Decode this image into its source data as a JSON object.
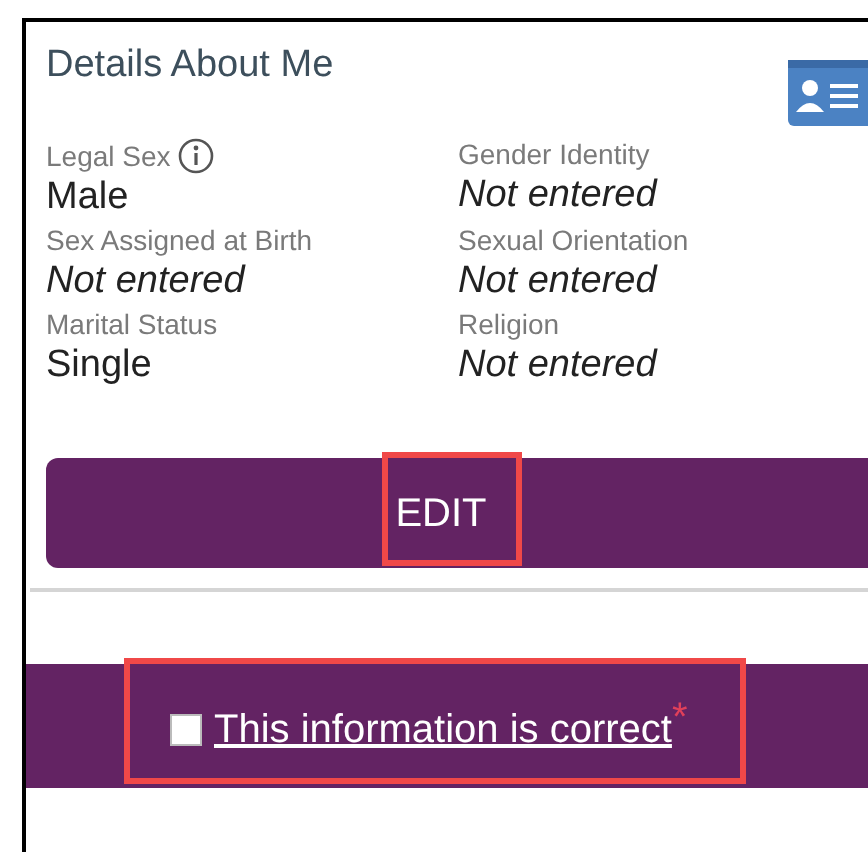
{
  "card": {
    "title": "Details About Me",
    "fields": [
      {
        "label": "Legal Sex",
        "value": "Male",
        "entered": true,
        "info": true
      },
      {
        "label": "Gender Identity",
        "value": "Not entered",
        "entered": false,
        "info": false
      },
      {
        "label": "Sex Assigned at Birth",
        "value": "Not entered",
        "entered": false,
        "info": false
      },
      {
        "label": "Sexual Orientation",
        "value": "Not entered",
        "entered": false,
        "info": false
      },
      {
        "label": "Marital Status",
        "value": "Single",
        "entered": true,
        "info": false
      },
      {
        "label": "Religion",
        "value": "Not entered",
        "entered": false,
        "info": false
      }
    ],
    "edit_button": {
      "label": "EDIT",
      "highlighted": true
    }
  },
  "confirm": {
    "label": "This information is correct",
    "checked": false,
    "required": "*",
    "highlighted": true
  }
}
